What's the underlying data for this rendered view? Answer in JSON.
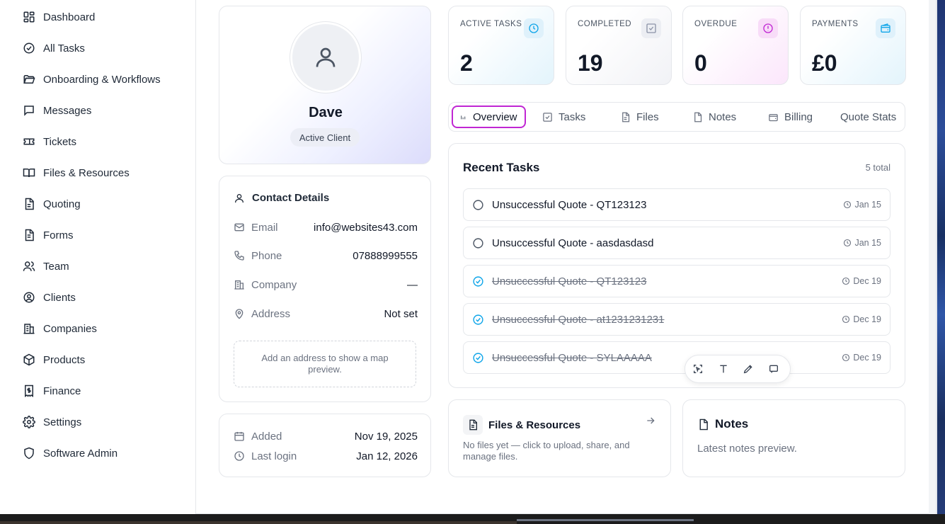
{
  "sidebar": {
    "items": [
      {
        "label": "Dashboard",
        "icon": "layout-dashboard-icon"
      },
      {
        "label": "All Tasks",
        "icon": "check-circle-icon"
      },
      {
        "label": "Onboarding & Workflows",
        "icon": "folder-open-icon"
      },
      {
        "label": "Messages",
        "icon": "message-square-icon"
      },
      {
        "label": "Tickets",
        "icon": "ticket-icon"
      },
      {
        "label": "Files & Resources",
        "icon": "book-open-icon"
      },
      {
        "label": "Quoting",
        "icon": "file-text-icon"
      },
      {
        "label": "Forms",
        "icon": "file-form-icon"
      },
      {
        "label": "Team",
        "icon": "users-icon"
      },
      {
        "label": "Clients",
        "icon": "user-circle-icon"
      },
      {
        "label": "Companies",
        "icon": "building-icon"
      },
      {
        "label": "Products",
        "icon": "package-icon"
      },
      {
        "label": "Finance",
        "icon": "receipt-icon"
      },
      {
        "label": "Settings",
        "icon": "gear-icon"
      },
      {
        "label": "Software Admin",
        "icon": "shield-icon"
      }
    ]
  },
  "profile": {
    "name": "Dave",
    "status": "Active Client"
  },
  "contact": {
    "title": "Contact Details",
    "rows": [
      {
        "label": "Email",
        "value": "info@websites43.com",
        "icon": "mail-icon"
      },
      {
        "label": "Phone",
        "value": "07888999555",
        "icon": "phone-icon"
      },
      {
        "label": "Company",
        "value": "—",
        "icon": "building-icon"
      },
      {
        "label": "Address",
        "value": "Not set",
        "icon": "map-pin-icon"
      }
    ],
    "map_placeholder": "Add an address to show a map preview."
  },
  "meta": {
    "added_label": "Added",
    "added_value": "Nov 19, 2025",
    "login_label": "Last login",
    "login_value": "Jan 12, 2026"
  },
  "stats": [
    {
      "label": "ACTIVE TASKS",
      "value": "2",
      "icon": "clock-icon",
      "color": "#0ea5e9"
    },
    {
      "label": "COMPLETED",
      "value": "19",
      "icon": "check-square-icon",
      "color": "#8b93a7"
    },
    {
      "label": "OVERDUE",
      "value": "0",
      "icon": "alert-circle-icon",
      "color": "#c026d3"
    },
    {
      "label": "PAYMENTS",
      "value": "£0",
      "icon": "wallet-icon",
      "color": "#0ea5e9"
    }
  ],
  "tabs": [
    {
      "label": "Overview",
      "icon": "bar-chart-icon",
      "active": true
    },
    {
      "label": "Tasks",
      "icon": "check-square-icon"
    },
    {
      "label": "Files",
      "icon": "file-text-icon"
    },
    {
      "label": "Notes",
      "icon": "file-icon"
    },
    {
      "label": "Billing",
      "icon": "wallet-icon"
    },
    {
      "label": "Quote Stats",
      "icon": ""
    }
  ],
  "recent_tasks": {
    "title": "Recent Tasks",
    "total": "5 total",
    "items": [
      {
        "name": "Unsuccessful Quote - QT123123",
        "date": "Jan 15",
        "done": false
      },
      {
        "name": "Unsuccessful Quote - aasdasdasd",
        "date": "Jan 15",
        "done": false
      },
      {
        "name": "Unsuccessful Quote - QT123123",
        "date": "Dec 19",
        "done": true
      },
      {
        "name": "Unsuccessful Quote - at1231231231",
        "date": "Dec 19",
        "done": true
      },
      {
        "name": "Unsuccessful Quote - SYLAAAAA",
        "date": "Dec 19",
        "done": true
      }
    ]
  },
  "files_card": {
    "title": "Files & Resources",
    "description": "No files yet — click to upload, share, and manage files."
  },
  "notes_card": {
    "title": "Notes",
    "description": "Latest notes preview."
  },
  "colors": {
    "accent": "#c026d3",
    "done_check": "#0ea5e9",
    "border": "#e5e7eb"
  }
}
